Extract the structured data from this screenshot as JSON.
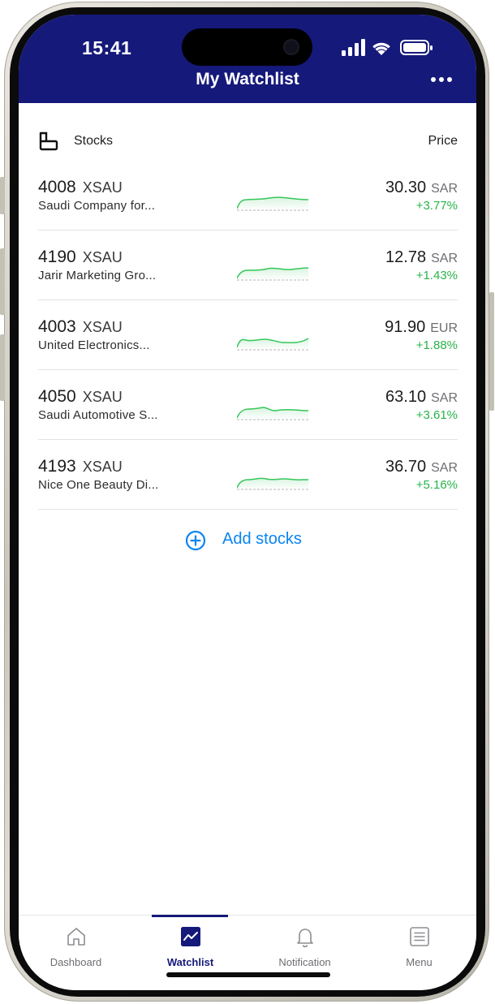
{
  "status": {
    "time": "15:41"
  },
  "header": {
    "title": "My Watchlist"
  },
  "list": {
    "stocks_label": "Stocks",
    "price_label": "Price",
    "rows": [
      {
        "code": "4008",
        "market": "XSAU",
        "name": "Saudi Company for...",
        "price": "30.30",
        "currency": "SAR",
        "change": "+3.77%"
      },
      {
        "code": "4190",
        "market": "XSAU",
        "name": "Jarir Marketing Gro...",
        "price": "12.78",
        "currency": "SAR",
        "change": "+1.43%"
      },
      {
        "code": "4003",
        "market": "XSAU",
        "name": "United Electronics...",
        "price": "91.90",
        "currency": "EUR",
        "change": "+1.88%"
      },
      {
        "code": "4050",
        "market": "XSAU",
        "name": "Saudi Automotive S...",
        "price": "63.10",
        "currency": "SAR",
        "change": "+3.61%"
      },
      {
        "code": "4193",
        "market": "XSAU",
        "name": "Nice One Beauty Di...",
        "price": "36.70",
        "currency": "SAR",
        "change": "+5.16%"
      }
    ]
  },
  "add_stocks_label": "Add stocks",
  "tabs": [
    {
      "label": "Dashboard",
      "icon": "home-icon"
    },
    {
      "label": "Watchlist",
      "icon": "chart-line-icon",
      "active": true
    },
    {
      "label": "Notification",
      "icon": "bell-icon"
    },
    {
      "label": "Menu",
      "icon": "list-icon"
    }
  ],
  "colors": {
    "header_bg": "#15197a",
    "positive": "#27b34a",
    "link": "#0a84f0"
  }
}
